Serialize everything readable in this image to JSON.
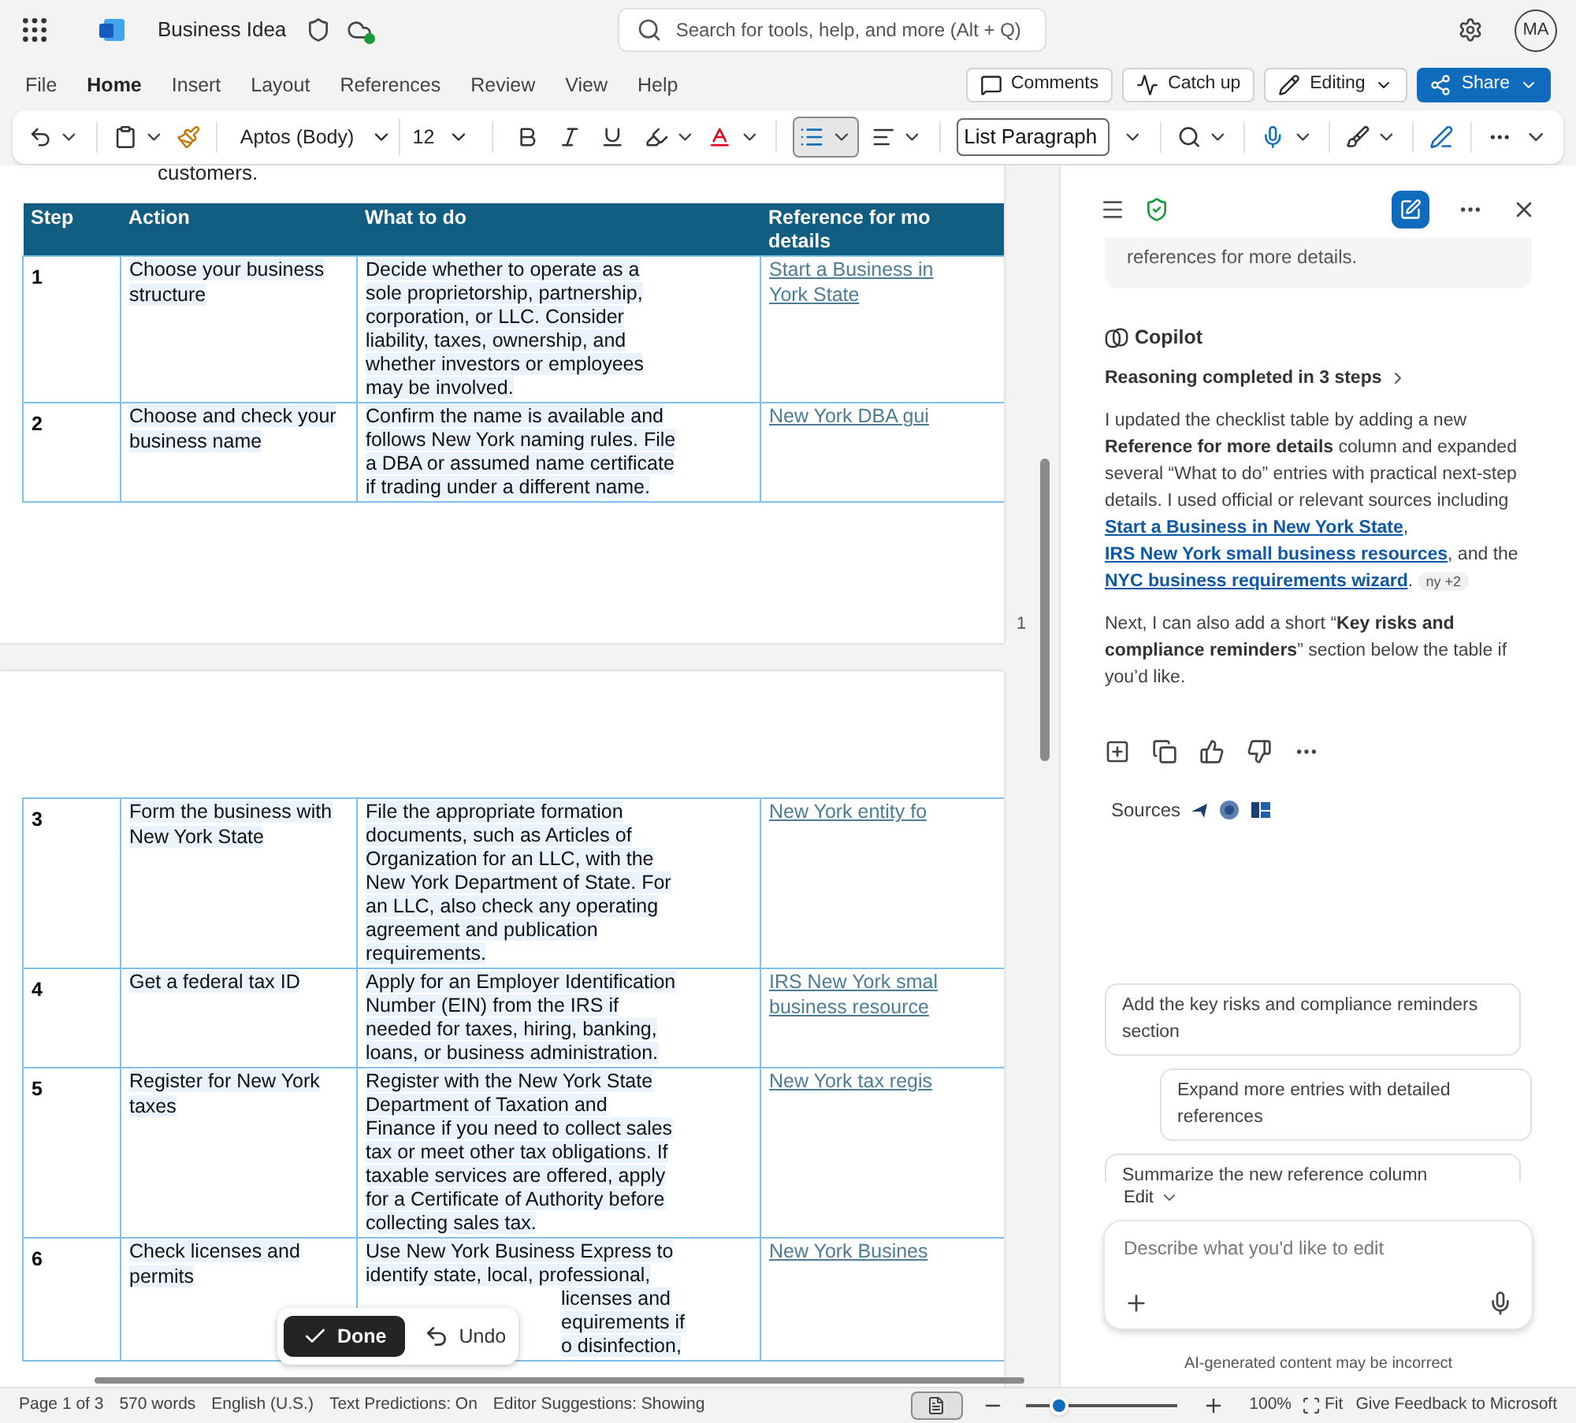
{
  "app_bar": {
    "title": "Business Idea",
    "search": {
      "placeholder": "Search for tools, help, and more (Alt + Q)"
    },
    "avatar": "MA"
  },
  "menu_tabs": [
    {
      "label": "File",
      "selected": false
    },
    {
      "label": "Home",
      "selected": true
    },
    {
      "label": "Insert",
      "selected": false
    },
    {
      "label": "Layout",
      "selected": false
    },
    {
      "label": "References",
      "selected": false
    },
    {
      "label": "Review",
      "selected": false
    },
    {
      "label": "View",
      "selected": false
    },
    {
      "label": "Help",
      "selected": false
    }
  ],
  "header_buttons": [
    {
      "label": "Comments",
      "kind": "comments"
    },
    {
      "label": "Catch up",
      "kind": "catchup"
    },
    {
      "label": "Editing",
      "kind": "editing"
    },
    {
      "label": "Share",
      "kind": "share"
    }
  ],
  "toolbar": {
    "font": "Aptos (Body)",
    "size": "12",
    "style": "List Paragraph",
    "bullets_selected": true
  },
  "document": {
    "intro_tail": "customers.",
    "page_number": "1",
    "columns": [
      [
        "Step"
      ],
      [
        "Action"
      ],
      [
        "What to do"
      ],
      [
        "Reference for mo",
        "details"
      ]
    ],
    "rows": [
      {
        "step": "1",
        "action": [
          "Choose your business",
          "structure"
        ],
        "what": [
          "Decide whether to operate as a",
          "sole proprietorship, partnership,",
          "corporation, or LLC. Consider",
          "liability, taxes, ownership, and",
          "whether investors or employees",
          "may be involved."
        ],
        "reference": [
          "Start a Business in",
          "York State"
        ]
      },
      {
        "step": "2",
        "action": [
          "Choose and check your",
          "business name"
        ],
        "what": [
          "Confirm the name is available and",
          "follows New York naming rules. File",
          "a DBA or assumed name certificate",
          "if trading under a different name."
        ],
        "reference": [
          "New York DBA gui"
        ]
      },
      {
        "step": "3",
        "action": [
          "Form the business with",
          "New York State"
        ],
        "what": [
          "File the appropriate formation",
          "documents, such as Articles of",
          "Organization for an LLC, with the",
          "New York Department of State. For",
          "an LLC, also check any operating",
          "agreement and publication",
          "requirements."
        ],
        "reference": [
          "New York entity fo"
        ]
      },
      {
        "step": "4",
        "action": [
          "Get a federal tax ID"
        ],
        "what": [
          "Apply for an Employer Identification",
          "Number (EIN) from the IRS if",
          "needed for taxes, hiring, banking,",
          "loans, or business administration."
        ],
        "reference": [
          "IRS New York smal",
          "business resource"
        ]
      },
      {
        "step": "5",
        "action": [
          "Register for New York",
          "taxes"
        ],
        "what": [
          "Register with the New York State",
          "Department of Taxation and",
          "Finance if you need to collect sales",
          "tax or meet other tax obligations. If",
          "taxable services are offered, apply",
          "for a Certificate of Authority before",
          "collecting sales tax."
        ],
        "reference": [
          "New York tax regis"
        ]
      },
      {
        "step": "6",
        "action": [
          "Check licenses and",
          "permits"
        ],
        "what": [
          "Use New York Business Express to",
          "identify state, local, professional,"
        ],
        "covered_lines": [
          "licenses and",
          "equirements if",
          "o disinfection,"
        ],
        "reference": [
          "New York Busines"
        ]
      }
    ]
  },
  "edit_bar": {
    "done": "Done",
    "undo": "Undo"
  },
  "copilot": {
    "prev_message_tail": "references for more details.",
    "author": "Copilot",
    "reasoning": "Reasoning completed in 3 steps",
    "paragraphs": [
      [
        {
          "kind": "text",
          "text": "I updated the checklist table by adding a new "
        },
        {
          "kind": "bold",
          "text": "Reference for more details"
        },
        {
          "kind": "text",
          "text": " column and expanded several “What to do” entries with practical next-step details. I used official or relevant sources including "
        },
        {
          "kind": "link",
          "text": "Start a Business in New York State"
        },
        {
          "kind": "text",
          "text": ", "
        },
        {
          "kind": "link",
          "text": "IRS New York small business resources"
        },
        {
          "kind": "text",
          "text": ", and the "
        },
        {
          "kind": "link",
          "text": "NYC business requirements wizard"
        },
        {
          "kind": "text",
          "text": ". "
        },
        {
          "kind": "pill",
          "text": "ny +2"
        }
      ],
      [
        {
          "kind": "text",
          "text": "Next, I can also add a short “"
        },
        {
          "kind": "bold",
          "text": "Key risks and compliance reminders"
        },
        {
          "kind": "text",
          "text": "” section below the table if you’d like."
        }
      ]
    ],
    "sources_label": "Sources",
    "suggestions": [
      "Add the key risks and compliance reminders section",
      "Expand more entries with detailed references",
      "Summarize the new reference column"
    ],
    "mode": "Edit",
    "input": {
      "placeholder": "Describe what you'd like to edit"
    },
    "disclaimer": "AI-generated content may be incorrect"
  },
  "status_bar": {
    "items": [
      "Page 1 of 3",
      "570 words",
      "English (U.S.)",
      "Text Predictions: On",
      "Editor Suggestions: Showing"
    ],
    "print_layout_selected": true,
    "zoom": {
      "level": 0.22,
      "reading": "100%"
    },
    "fit": "Fit",
    "feedback": "Give Feedback to Microsoft"
  }
}
